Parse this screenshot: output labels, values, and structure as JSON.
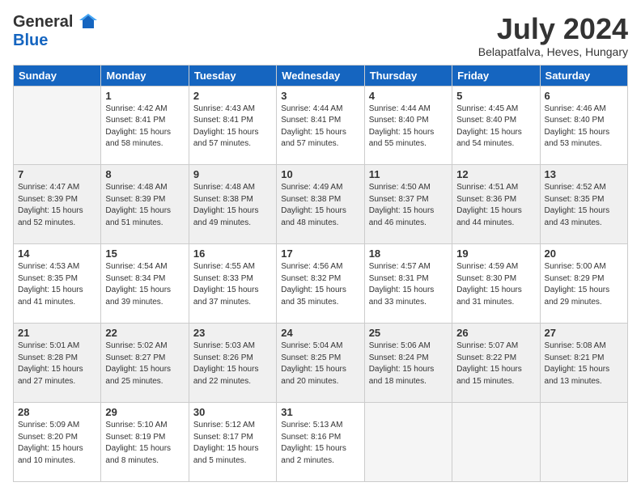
{
  "header": {
    "logo_line1": "General",
    "logo_line2": "Blue",
    "title": "July 2024",
    "location": "Belapatfalva, Heves, Hungary"
  },
  "days_of_week": [
    "Sunday",
    "Monday",
    "Tuesday",
    "Wednesday",
    "Thursday",
    "Friday",
    "Saturday"
  ],
  "weeks": [
    [
      {
        "day": "",
        "sunrise": "",
        "sunset": "",
        "daylight": ""
      },
      {
        "day": "1",
        "sunrise": "Sunrise: 4:42 AM",
        "sunset": "Sunset: 8:41 PM",
        "daylight": "Daylight: 15 hours and 58 minutes."
      },
      {
        "day": "2",
        "sunrise": "Sunrise: 4:43 AM",
        "sunset": "Sunset: 8:41 PM",
        "daylight": "Daylight: 15 hours and 57 minutes."
      },
      {
        "day": "3",
        "sunrise": "Sunrise: 4:44 AM",
        "sunset": "Sunset: 8:41 PM",
        "daylight": "Daylight: 15 hours and 57 minutes."
      },
      {
        "day": "4",
        "sunrise": "Sunrise: 4:44 AM",
        "sunset": "Sunset: 8:40 PM",
        "daylight": "Daylight: 15 hours and 55 minutes."
      },
      {
        "day": "5",
        "sunrise": "Sunrise: 4:45 AM",
        "sunset": "Sunset: 8:40 PM",
        "daylight": "Daylight: 15 hours and 54 minutes."
      },
      {
        "day": "6",
        "sunrise": "Sunrise: 4:46 AM",
        "sunset": "Sunset: 8:40 PM",
        "daylight": "Daylight: 15 hours and 53 minutes."
      }
    ],
    [
      {
        "day": "7",
        "sunrise": "Sunrise: 4:47 AM",
        "sunset": "Sunset: 8:39 PM",
        "daylight": "Daylight: 15 hours and 52 minutes."
      },
      {
        "day": "8",
        "sunrise": "Sunrise: 4:48 AM",
        "sunset": "Sunset: 8:39 PM",
        "daylight": "Daylight: 15 hours and 51 minutes."
      },
      {
        "day": "9",
        "sunrise": "Sunrise: 4:48 AM",
        "sunset": "Sunset: 8:38 PM",
        "daylight": "Daylight: 15 hours and 49 minutes."
      },
      {
        "day": "10",
        "sunrise": "Sunrise: 4:49 AM",
        "sunset": "Sunset: 8:38 PM",
        "daylight": "Daylight: 15 hours and 48 minutes."
      },
      {
        "day": "11",
        "sunrise": "Sunrise: 4:50 AM",
        "sunset": "Sunset: 8:37 PM",
        "daylight": "Daylight: 15 hours and 46 minutes."
      },
      {
        "day": "12",
        "sunrise": "Sunrise: 4:51 AM",
        "sunset": "Sunset: 8:36 PM",
        "daylight": "Daylight: 15 hours and 44 minutes."
      },
      {
        "day": "13",
        "sunrise": "Sunrise: 4:52 AM",
        "sunset": "Sunset: 8:35 PM",
        "daylight": "Daylight: 15 hours and 43 minutes."
      }
    ],
    [
      {
        "day": "14",
        "sunrise": "Sunrise: 4:53 AM",
        "sunset": "Sunset: 8:35 PM",
        "daylight": "Daylight: 15 hours and 41 minutes."
      },
      {
        "day": "15",
        "sunrise": "Sunrise: 4:54 AM",
        "sunset": "Sunset: 8:34 PM",
        "daylight": "Daylight: 15 hours and 39 minutes."
      },
      {
        "day": "16",
        "sunrise": "Sunrise: 4:55 AM",
        "sunset": "Sunset: 8:33 PM",
        "daylight": "Daylight: 15 hours and 37 minutes."
      },
      {
        "day": "17",
        "sunrise": "Sunrise: 4:56 AM",
        "sunset": "Sunset: 8:32 PM",
        "daylight": "Daylight: 15 hours and 35 minutes."
      },
      {
        "day": "18",
        "sunrise": "Sunrise: 4:57 AM",
        "sunset": "Sunset: 8:31 PM",
        "daylight": "Daylight: 15 hours and 33 minutes."
      },
      {
        "day": "19",
        "sunrise": "Sunrise: 4:59 AM",
        "sunset": "Sunset: 8:30 PM",
        "daylight": "Daylight: 15 hours and 31 minutes."
      },
      {
        "day": "20",
        "sunrise": "Sunrise: 5:00 AM",
        "sunset": "Sunset: 8:29 PM",
        "daylight": "Daylight: 15 hours and 29 minutes."
      }
    ],
    [
      {
        "day": "21",
        "sunrise": "Sunrise: 5:01 AM",
        "sunset": "Sunset: 8:28 PM",
        "daylight": "Daylight: 15 hours and 27 minutes."
      },
      {
        "day": "22",
        "sunrise": "Sunrise: 5:02 AM",
        "sunset": "Sunset: 8:27 PM",
        "daylight": "Daylight: 15 hours and 25 minutes."
      },
      {
        "day": "23",
        "sunrise": "Sunrise: 5:03 AM",
        "sunset": "Sunset: 8:26 PM",
        "daylight": "Daylight: 15 hours and 22 minutes."
      },
      {
        "day": "24",
        "sunrise": "Sunrise: 5:04 AM",
        "sunset": "Sunset: 8:25 PM",
        "daylight": "Daylight: 15 hours and 20 minutes."
      },
      {
        "day": "25",
        "sunrise": "Sunrise: 5:06 AM",
        "sunset": "Sunset: 8:24 PM",
        "daylight": "Daylight: 15 hours and 18 minutes."
      },
      {
        "day": "26",
        "sunrise": "Sunrise: 5:07 AM",
        "sunset": "Sunset: 8:22 PM",
        "daylight": "Daylight: 15 hours and 15 minutes."
      },
      {
        "day": "27",
        "sunrise": "Sunrise: 5:08 AM",
        "sunset": "Sunset: 8:21 PM",
        "daylight": "Daylight: 15 hours and 13 minutes."
      }
    ],
    [
      {
        "day": "28",
        "sunrise": "Sunrise: 5:09 AM",
        "sunset": "Sunset: 8:20 PM",
        "daylight": "Daylight: 15 hours and 10 minutes."
      },
      {
        "day": "29",
        "sunrise": "Sunrise: 5:10 AM",
        "sunset": "Sunset: 8:19 PM",
        "daylight": "Daylight: 15 hours and 8 minutes."
      },
      {
        "day": "30",
        "sunrise": "Sunrise: 5:12 AM",
        "sunset": "Sunset: 8:17 PM",
        "daylight": "Daylight: 15 hours and 5 minutes."
      },
      {
        "day": "31",
        "sunrise": "Sunrise: 5:13 AM",
        "sunset": "Sunset: 8:16 PM",
        "daylight": "Daylight: 15 hours and 2 minutes."
      },
      {
        "day": "",
        "sunrise": "",
        "sunset": "",
        "daylight": ""
      },
      {
        "day": "",
        "sunrise": "",
        "sunset": "",
        "daylight": ""
      },
      {
        "day": "",
        "sunrise": "",
        "sunset": "",
        "daylight": ""
      }
    ]
  ]
}
